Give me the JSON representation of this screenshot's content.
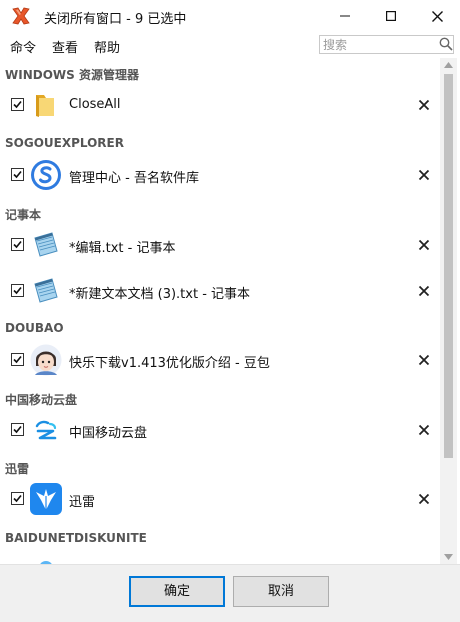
{
  "window": {
    "title": "关闭所有窗口 - 9 已选中"
  },
  "menu": {
    "items": [
      "命令",
      "查看",
      "帮助"
    ]
  },
  "search": {
    "placeholder": "搜索"
  },
  "groups": [
    {
      "name": "WINDOWS 资源管理器",
      "items": [
        {
          "label": "CloseAll",
          "icon": "folder-icon",
          "checked": true
        }
      ]
    },
    {
      "name": "SOGOUEXPLORER",
      "items": [
        {
          "label": "管理中心 - 吾名软件库",
          "icon": "sogou-explorer-icon",
          "checked": true
        }
      ]
    },
    {
      "name": "记事本",
      "items": [
        {
          "label": "*编辑.txt - 记事本",
          "icon": "notepad-icon",
          "checked": true
        },
        {
          "label": "*新建文本文档 (3).txt - 记事本",
          "icon": "notepad-icon",
          "checked": true
        }
      ]
    },
    {
      "name": "DOUBAO",
      "items": [
        {
          "label": "快乐下载v1.413优化版介绍 - 豆包",
          "icon": "doubao-avatar-icon",
          "checked": true
        }
      ]
    },
    {
      "name": "中国移动云盘",
      "items": [
        {
          "label": "中国移动云盘",
          "icon": "cloud-drive-icon",
          "checked": true
        }
      ]
    },
    {
      "name": "迅雷",
      "items": [
        {
          "label": "迅雷",
          "icon": "xunlei-icon",
          "checked": true
        }
      ]
    },
    {
      "name": "BAIDUNETDISKUNITE",
      "items": []
    }
  ],
  "buttons": {
    "ok": "确定",
    "cancel": "取消"
  }
}
